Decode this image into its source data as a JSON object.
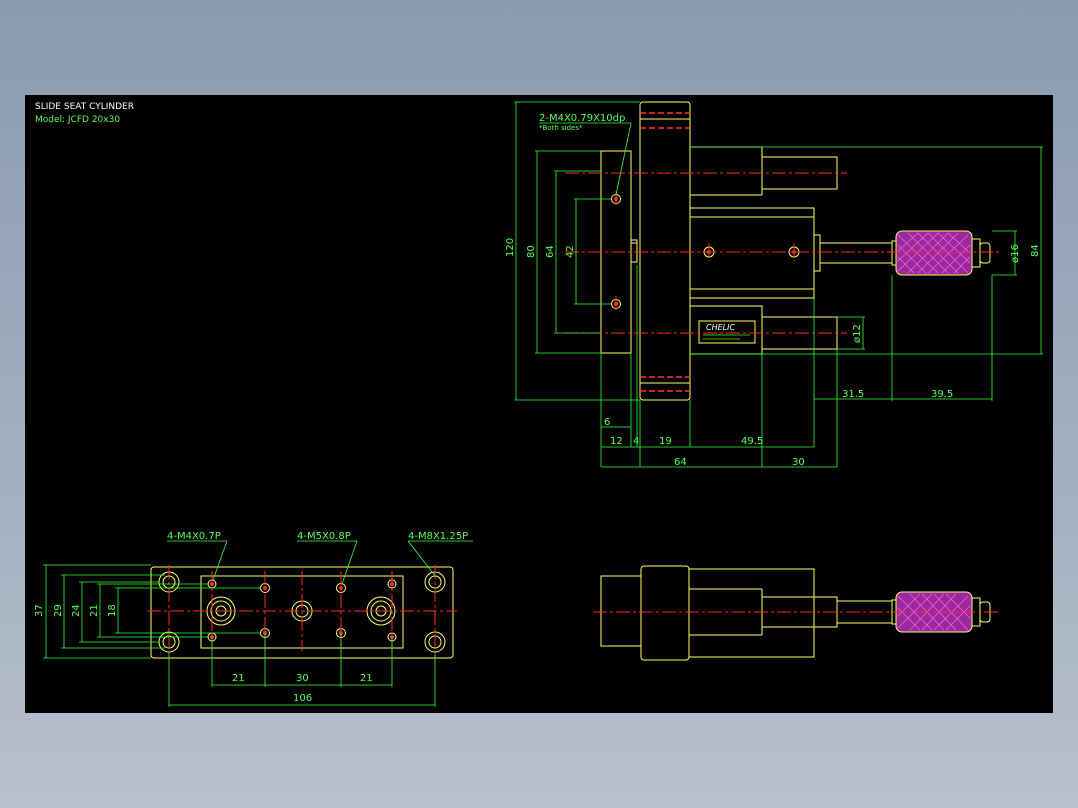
{
  "title": "SLIDE SEAT CYLINDER",
  "model": "Model: JCFD 20x30",
  "logo_text": "CHELIC",
  "colors": {
    "background": "#000000",
    "part": "#ffff66",
    "dimension": "#33ff33",
    "center": "#ff2a2a",
    "knob": "#d040d0"
  },
  "top_view": {
    "callout_thread": "2-M4X0.79X10dp",
    "callout_sides": "*Both sides*",
    "dims_vertical": {
      "d120": "120",
      "d80": "80",
      "d64": "64",
      "d42": "42"
    },
    "dims_right": {
      "d16": "ø16",
      "d84": "84",
      "d12": "ø12"
    },
    "dims_horizontal": {
      "d6": "6",
      "d12": "12",
      "d4": "4",
      "d19": "19",
      "d49": "49.5",
      "d64": "64",
      "d30": "30",
      "d31": "31.5",
      "d39": "39.5"
    }
  },
  "bottom_view": {
    "callouts": {
      "m4": "4-M4X0.7P",
      "m5": "4-M5X0.8P",
      "m8": "4-M8X1.25P"
    },
    "dims_vertical": {
      "d37": "37",
      "d29": "29",
      "d24": "24",
      "d21": "21",
      "d18": "18"
    },
    "dims_horizontal": {
      "d21a": "21",
      "d30": "30",
      "d21b": "21",
      "d106": "106"
    }
  }
}
